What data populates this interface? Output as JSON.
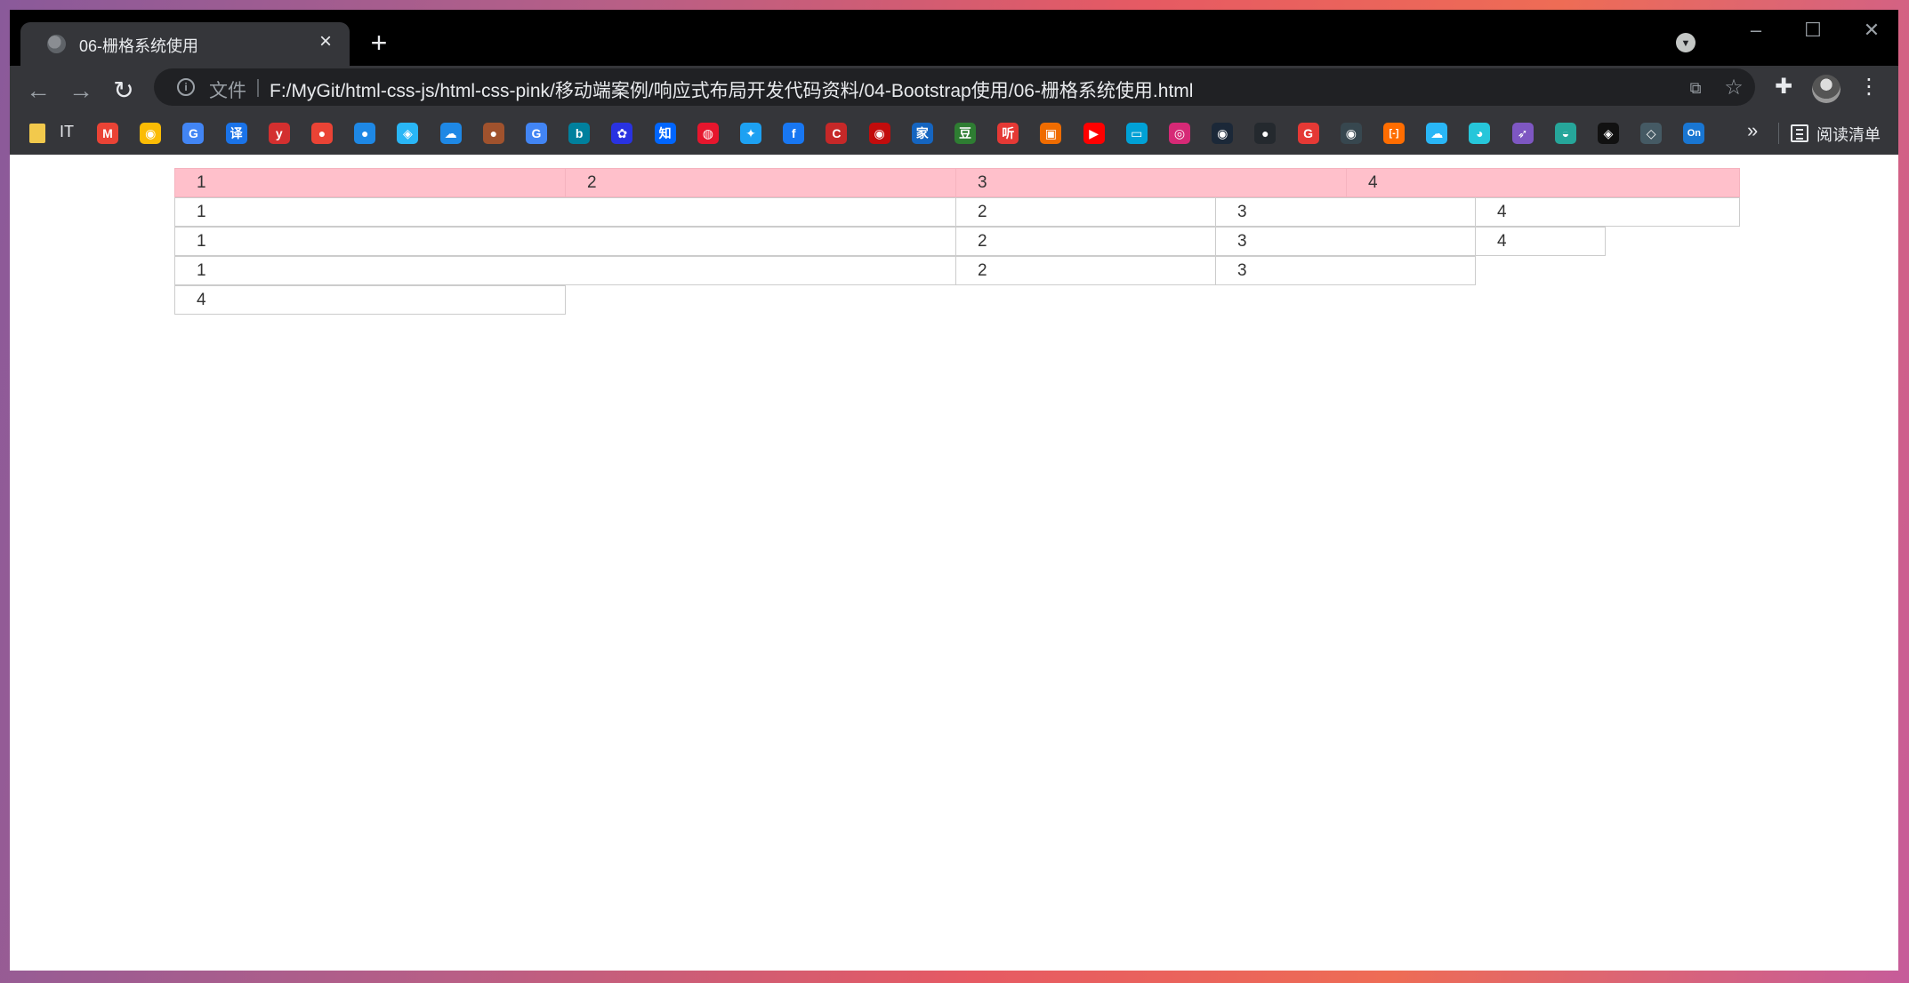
{
  "browser": {
    "tab": {
      "title": "06-栅格系统使用"
    },
    "window_controls": {
      "minimize": "–",
      "maximize": "☐",
      "close": "✕"
    },
    "address": {
      "scheme_label": "文件",
      "url": "F:/MyGit/html-css-js/html-css-pink/移动端案例/响应式布局开发代码资料/04-Bootstrap使用/06-栅格系统使用.html"
    },
    "bookmarks": {
      "first_label": "IT",
      "reading_list": "阅读清单",
      "icons": [
        {
          "name": "gmail-icon",
          "glyph": "M",
          "color": "#ea4335"
        },
        {
          "name": "chrome-icon",
          "glyph": "◉",
          "color": "#fbbc05"
        },
        {
          "name": "google-translate-icon",
          "glyph": "G",
          "color": "#4285f4"
        },
        {
          "name": "youdao-translate-icon",
          "glyph": "译",
          "color": "#1a73e8"
        },
        {
          "name": "yinxiang-icon",
          "glyph": "y",
          "color": "#d32f2f"
        },
        {
          "name": "maps-icon",
          "glyph": "●",
          "color": "#ea4335"
        },
        {
          "name": "globe-icon",
          "glyph": "●",
          "color": "#1e88e5"
        },
        {
          "name": "cloud-share-icon",
          "glyph": "◈",
          "color": "#29b6f6"
        },
        {
          "name": "baidu-netdisk-icon",
          "glyph": "☁",
          "color": "#1e88e5"
        },
        {
          "name": "acorn-icon",
          "glyph": "●",
          "color": "#a0522d"
        },
        {
          "name": "google-icon",
          "glyph": "G",
          "color": "#4285f4"
        },
        {
          "name": "bing-icon",
          "glyph": "b",
          "color": "#00809d"
        },
        {
          "name": "baidu-icon",
          "glyph": "✿",
          "color": "#2932e1"
        },
        {
          "name": "zhihu-icon",
          "glyph": "知",
          "color": "#0066ff"
        },
        {
          "name": "weibo-icon",
          "glyph": "◍",
          "color": "#e6162d"
        },
        {
          "name": "twitter-icon",
          "glyph": "✦",
          "color": "#1da1f2"
        },
        {
          "name": "facebook-icon",
          "glyph": "f",
          "color": "#1877f2"
        },
        {
          "name": "csdn-icon",
          "glyph": "C",
          "color": "#c62828"
        },
        {
          "name": "netease-music-icon",
          "glyph": "◉",
          "color": "#c20c0c"
        },
        {
          "name": "jia-icon",
          "glyph": "家",
          "color": "#1565c0"
        },
        {
          "name": "douban-icon",
          "glyph": "豆",
          "color": "#2e7d32"
        },
        {
          "name": "ting-icon",
          "glyph": "听",
          "color": "#e53935"
        },
        {
          "name": "bilibili-game-icon",
          "glyph": "▣",
          "color": "#ef6c00"
        },
        {
          "name": "youtube-icon",
          "glyph": "▶",
          "color": "#ff0000"
        },
        {
          "name": "bilibili-icon",
          "glyph": "▭",
          "color": "#00a1d6"
        },
        {
          "name": "instagram-icon",
          "glyph": "◎",
          "color": "#d62976"
        },
        {
          "name": "steam-icon",
          "glyph": "◉",
          "color": "#1b2838"
        },
        {
          "name": "github-icon",
          "glyph": "●",
          "color": "#24292e"
        },
        {
          "name": "g-red-icon",
          "glyph": "G",
          "color": "#e53935"
        },
        {
          "name": "dark-app-icon",
          "glyph": "◉",
          "color": "#37474f"
        },
        {
          "name": "bracket-icon",
          "glyph": "[-]",
          "color": "#ff6d00"
        },
        {
          "name": "cloud-icon",
          "glyph": "☁",
          "color": "#29b6f6"
        },
        {
          "name": "bird-icon",
          "glyph": "◕",
          "color": "#26c6da"
        },
        {
          "name": "rocket-icon",
          "glyph": "➶",
          "color": "#7e57c2"
        },
        {
          "name": "ufo-icon",
          "glyph": "◒",
          "color": "#26a69a"
        },
        {
          "name": "codepen-icon",
          "glyph": "◈",
          "color": "#111111"
        },
        {
          "name": "cube-icon",
          "glyph": "◇",
          "color": "#455a64"
        },
        {
          "name": "on-icon",
          "glyph": "On",
          "color": "#1976d2"
        }
      ],
      "more": "»"
    }
  },
  "page": {
    "rows": [
      {
        "pink": true,
        "cells": [
          "1",
          "2",
          "3",
          "4"
        ]
      },
      {
        "pink": false,
        "cells": [
          "1",
          "2",
          "3",
          "4"
        ]
      },
      {
        "pink": false,
        "cells": [
          "1",
          "2",
          "3",
          "4"
        ]
      },
      {
        "pink": false,
        "cells": [
          "1",
          "2",
          "3",
          "4"
        ]
      }
    ],
    "colors": {
      "highlight": "#ffc0cb",
      "border": "#cccccc",
      "text": "#333333"
    }
  }
}
